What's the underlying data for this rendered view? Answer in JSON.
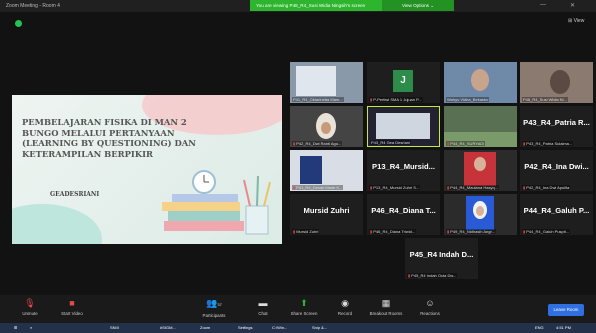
{
  "window": {
    "title": "Zoom Meeting - Room 4",
    "banner": "You are viewing P48_R4_Susi Widia Ningsih's screen",
    "view_options": "View Options ⌄",
    "view": "⊞ View"
  },
  "slide": {
    "title": "PEMBELAJARAN FISIKA DI MAN 2 BUNGO MELALUI PERTANYAAN (LEARNING BY QUESTIONING) DAN KETERAMPILAN BERPIKIR",
    "author": "GEADESRIANI"
  },
  "tiles": [
    {
      "name": "P41_R4_Oktarinetta Mam...",
      "big": ""
    },
    {
      "name": "P-Pertiwi SMA 1 Jujuan P...",
      "big": "",
      "avatar": "J"
    },
    {
      "name": "Wahyu Vidha_Bekasbo",
      "big": ""
    },
    {
      "name": "P48_R4_Susi Widia Ni...",
      "big": ""
    },
    {
      "name": "P42_R4_Dwi Ranti Agu...",
      "big": ""
    },
    {
      "name": "P43_R4 Gea Desriani",
      "big": ""
    },
    {
      "name": "P44_R4_SURYADI",
      "big": ""
    },
    {
      "name": "P43_R4_Patria Sulaima...",
      "big": "P43_R4_Patria R..."
    },
    {
      "name": "P41_R4_Desak Made K...",
      "big": ""
    },
    {
      "name": "P13_R4_Mursid Zuhri S...",
      "big": "P13_R4_Mursid..."
    },
    {
      "name": "P44_R4_Maulana Hasyq...",
      "big": ""
    },
    {
      "name": "P42_R4_Ina Dwi Apulita",
      "big": "P42_R4_Ina Dwi..."
    },
    {
      "name": "Mursid Zuhri",
      "big": "Mursid Zuhri"
    },
    {
      "name": "P46_R4_Diana Triwid...",
      "big": "P46_R4_Diana T..."
    },
    {
      "name": "P49_R4_Nidhasih Angr...",
      "big": ""
    },
    {
      "name": "P44_R4_Galuh Puspit...",
      "big": "P44_R4_Galuh P..."
    },
    {
      "name": "P45_R4 Indah Octa Dw...",
      "big": "P45_R4 Indah D..."
    }
  ],
  "toolbar": {
    "unmute": "Unmute",
    "start_video": "Start Video",
    "participants": "Participants",
    "participants_count": "37",
    "chat": "Chat",
    "share_screen": "Share Screen",
    "record": "Record",
    "breakout": "Breakout Rooms",
    "reactions": "Reactions",
    "leave": "Leave Room"
  },
  "taskbar": {
    "items": [
      "SNIII",
      "#SIGM...",
      "Zoom",
      "Settings",
      "C:\\Win...",
      "Snip &...",
      "ENG",
      "4:51 PM"
    ]
  }
}
